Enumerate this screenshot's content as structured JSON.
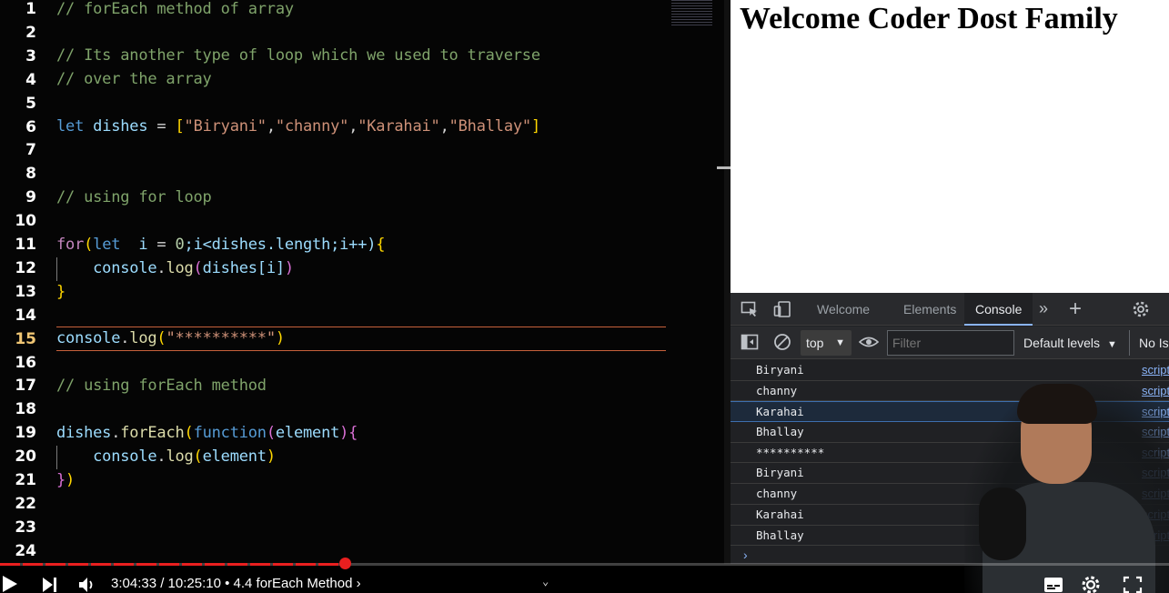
{
  "editor": {
    "lines": [
      {
        "n": "1"
      },
      {
        "n": "2"
      },
      {
        "n": "3"
      },
      {
        "n": "4"
      },
      {
        "n": "5"
      },
      {
        "n": "6"
      },
      {
        "n": "7"
      },
      {
        "n": "8"
      },
      {
        "n": "9"
      },
      {
        "n": "10"
      },
      {
        "n": "11"
      },
      {
        "n": "12"
      },
      {
        "n": "13"
      },
      {
        "n": "14"
      },
      {
        "n": "15"
      },
      {
        "n": "16"
      },
      {
        "n": "17"
      },
      {
        "n": "18"
      },
      {
        "n": "19"
      },
      {
        "n": "20"
      },
      {
        "n": "21"
      },
      {
        "n": "22"
      },
      {
        "n": "23"
      },
      {
        "n": "24"
      }
    ],
    "active_line": "15",
    "code": {
      "l1": "// forEach method of array",
      "l3": "// Its another type of loop which we used to traverse",
      "l4": "// over the array",
      "l6_kw": "let",
      "l6_var": "dishes",
      "l6_eq": " = ",
      "l6_s1": "\"Biryani\"",
      "l6_s2": "\"channy\"",
      "l6_s3": "\"Karahai\"",
      "l6_s4": "\"Bhallay\"",
      "l9": "// using for loop",
      "l11_for": "for",
      "l11_let": "let",
      "l11_i": "  i",
      "l11_eq": " = ",
      "l11_zero": "0",
      "l11_rest": ";i<dishes.",
      "l11_len": "length",
      "l11_tail": ";i++)",
      "l12_console": "console",
      "l12_log": "log",
      "l12_arg": "dishes[i]",
      "l15_console": "console",
      "l15_log": "log",
      "l15_str": "\"**********\"",
      "l17": "// using forEach method",
      "l19_var": "dishes",
      "l19_fn": "forEach",
      "l19_function": "function",
      "l19_param": "element",
      "l20_console": "console",
      "l20_log": "log",
      "l20_arg": "element"
    }
  },
  "page": {
    "heading": "Welcome Coder Dost Family"
  },
  "devtools": {
    "tabs": [
      "Welcome",
      "Elements",
      "Console"
    ],
    "active_tab": "Console",
    "context": "top",
    "filter_placeholder": "Filter",
    "levels": "Default levels",
    "issues": "No Iss",
    "logs": [
      {
        "text": "Biryani",
        "src": "script.js"
      },
      {
        "text": "channy",
        "src": "script.js"
      },
      {
        "text": "Karahai",
        "src": "script.js",
        "selected": true
      },
      {
        "text": "Bhallay",
        "src": "script.js"
      },
      {
        "text": "**********",
        "src": "script.js"
      },
      {
        "text": "Biryani",
        "src": "script.js"
      },
      {
        "text": "channy",
        "src": "script.js"
      },
      {
        "text": "Karahai",
        "src": "script.js"
      },
      {
        "text": "Bhallay",
        "src": "script.js"
      }
    ]
  },
  "player": {
    "time": "3:04:33 / 10:25:10 • 4.4 forEach Method ›",
    "progress_fraction": 0.295,
    "buffer_fraction": 0.26,
    "accent": "#e91f1f"
  },
  "colors": {
    "comment": "#7fa36a",
    "keyword": "#569cd6",
    "string": "#ce9178",
    "function": "#dcdcaa"
  }
}
